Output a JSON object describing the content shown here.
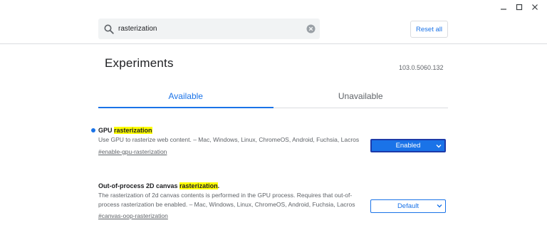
{
  "window": {
    "minimize_icon": "minimize-icon",
    "maximize_icon": "maximize-icon",
    "close_icon": "close-icon"
  },
  "search": {
    "value": "rasterization",
    "icon": "search-icon",
    "clear_icon": "clear-icon"
  },
  "header": {
    "reset_label": "Reset all"
  },
  "page": {
    "title": "Experiments",
    "version": "103.0.5060.132"
  },
  "tabs": [
    {
      "label": "Available",
      "active": true
    },
    {
      "label": "Unavailable",
      "active": false
    }
  ],
  "experiments": [
    {
      "title_prefix": "GPU ",
      "title_highlight": "rasterization",
      "title_suffix": "",
      "modified": true,
      "description": "Use GPU to rasterize web content. – Mac, Windows, Linux, ChromeOS, Android, Fuchsia, Lacros",
      "link": "#enable-gpu-rasterization",
      "select_value": "Enabled"
    },
    {
      "title_prefix": "Out-of-process 2D canvas ",
      "title_highlight": "rasterization",
      "title_suffix": ".",
      "modified": false,
      "description": "The rasterization of 2d canvas contents is performed in the GPU process. Requires that out-of-process rasterization be enabled. – Mac, Windows, Linux, ChromeOS, Android, Fuchsia, Lacros",
      "link": "#canvas-oop-rasterization",
      "select_value": "Default"
    }
  ],
  "colors": {
    "accent": "#1a73e8",
    "highlight": "#ffff00",
    "search_bg": "#f1f3f4"
  }
}
